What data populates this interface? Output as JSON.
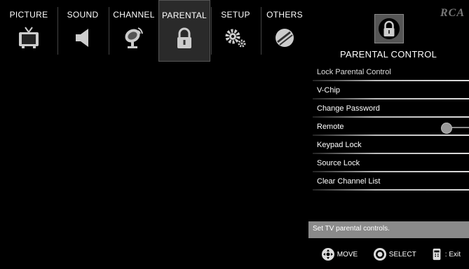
{
  "tabs": [
    {
      "label": "PICTURE",
      "icon": "tv-icon"
    },
    {
      "label": "SOUND",
      "icon": "speaker-icon"
    },
    {
      "label": "CHANNEL",
      "icon": "satellite-dish-icon"
    },
    {
      "label": "PARENTAL",
      "icon": "padlock-icon",
      "active": true
    },
    {
      "label": "SETUP",
      "icon": "gears-icon"
    },
    {
      "label": "OTHERS",
      "icon": "others-disc-icon"
    }
  ],
  "brand": "RCA",
  "panel": {
    "title": "PARENTAL CONTROL",
    "icon": "padlock-icon"
  },
  "menu_items": [
    {
      "label": "Lock Parental Control",
      "type": "header"
    },
    {
      "label": "V-Chip"
    },
    {
      "label": "Change Password"
    },
    {
      "label": "Remote",
      "toggle": true
    },
    {
      "label": "Keypad Lock"
    },
    {
      "label": "Source Lock"
    },
    {
      "label": "Clear Channel List"
    }
  ],
  "help_text": "Set TV parental controls.",
  "legend": {
    "move_label": "MOVE",
    "select_label": "SELECT",
    "exit_label": ": Exit"
  },
  "colors": {
    "background": "#000000",
    "help_bar": "#8a8a8a"
  }
}
